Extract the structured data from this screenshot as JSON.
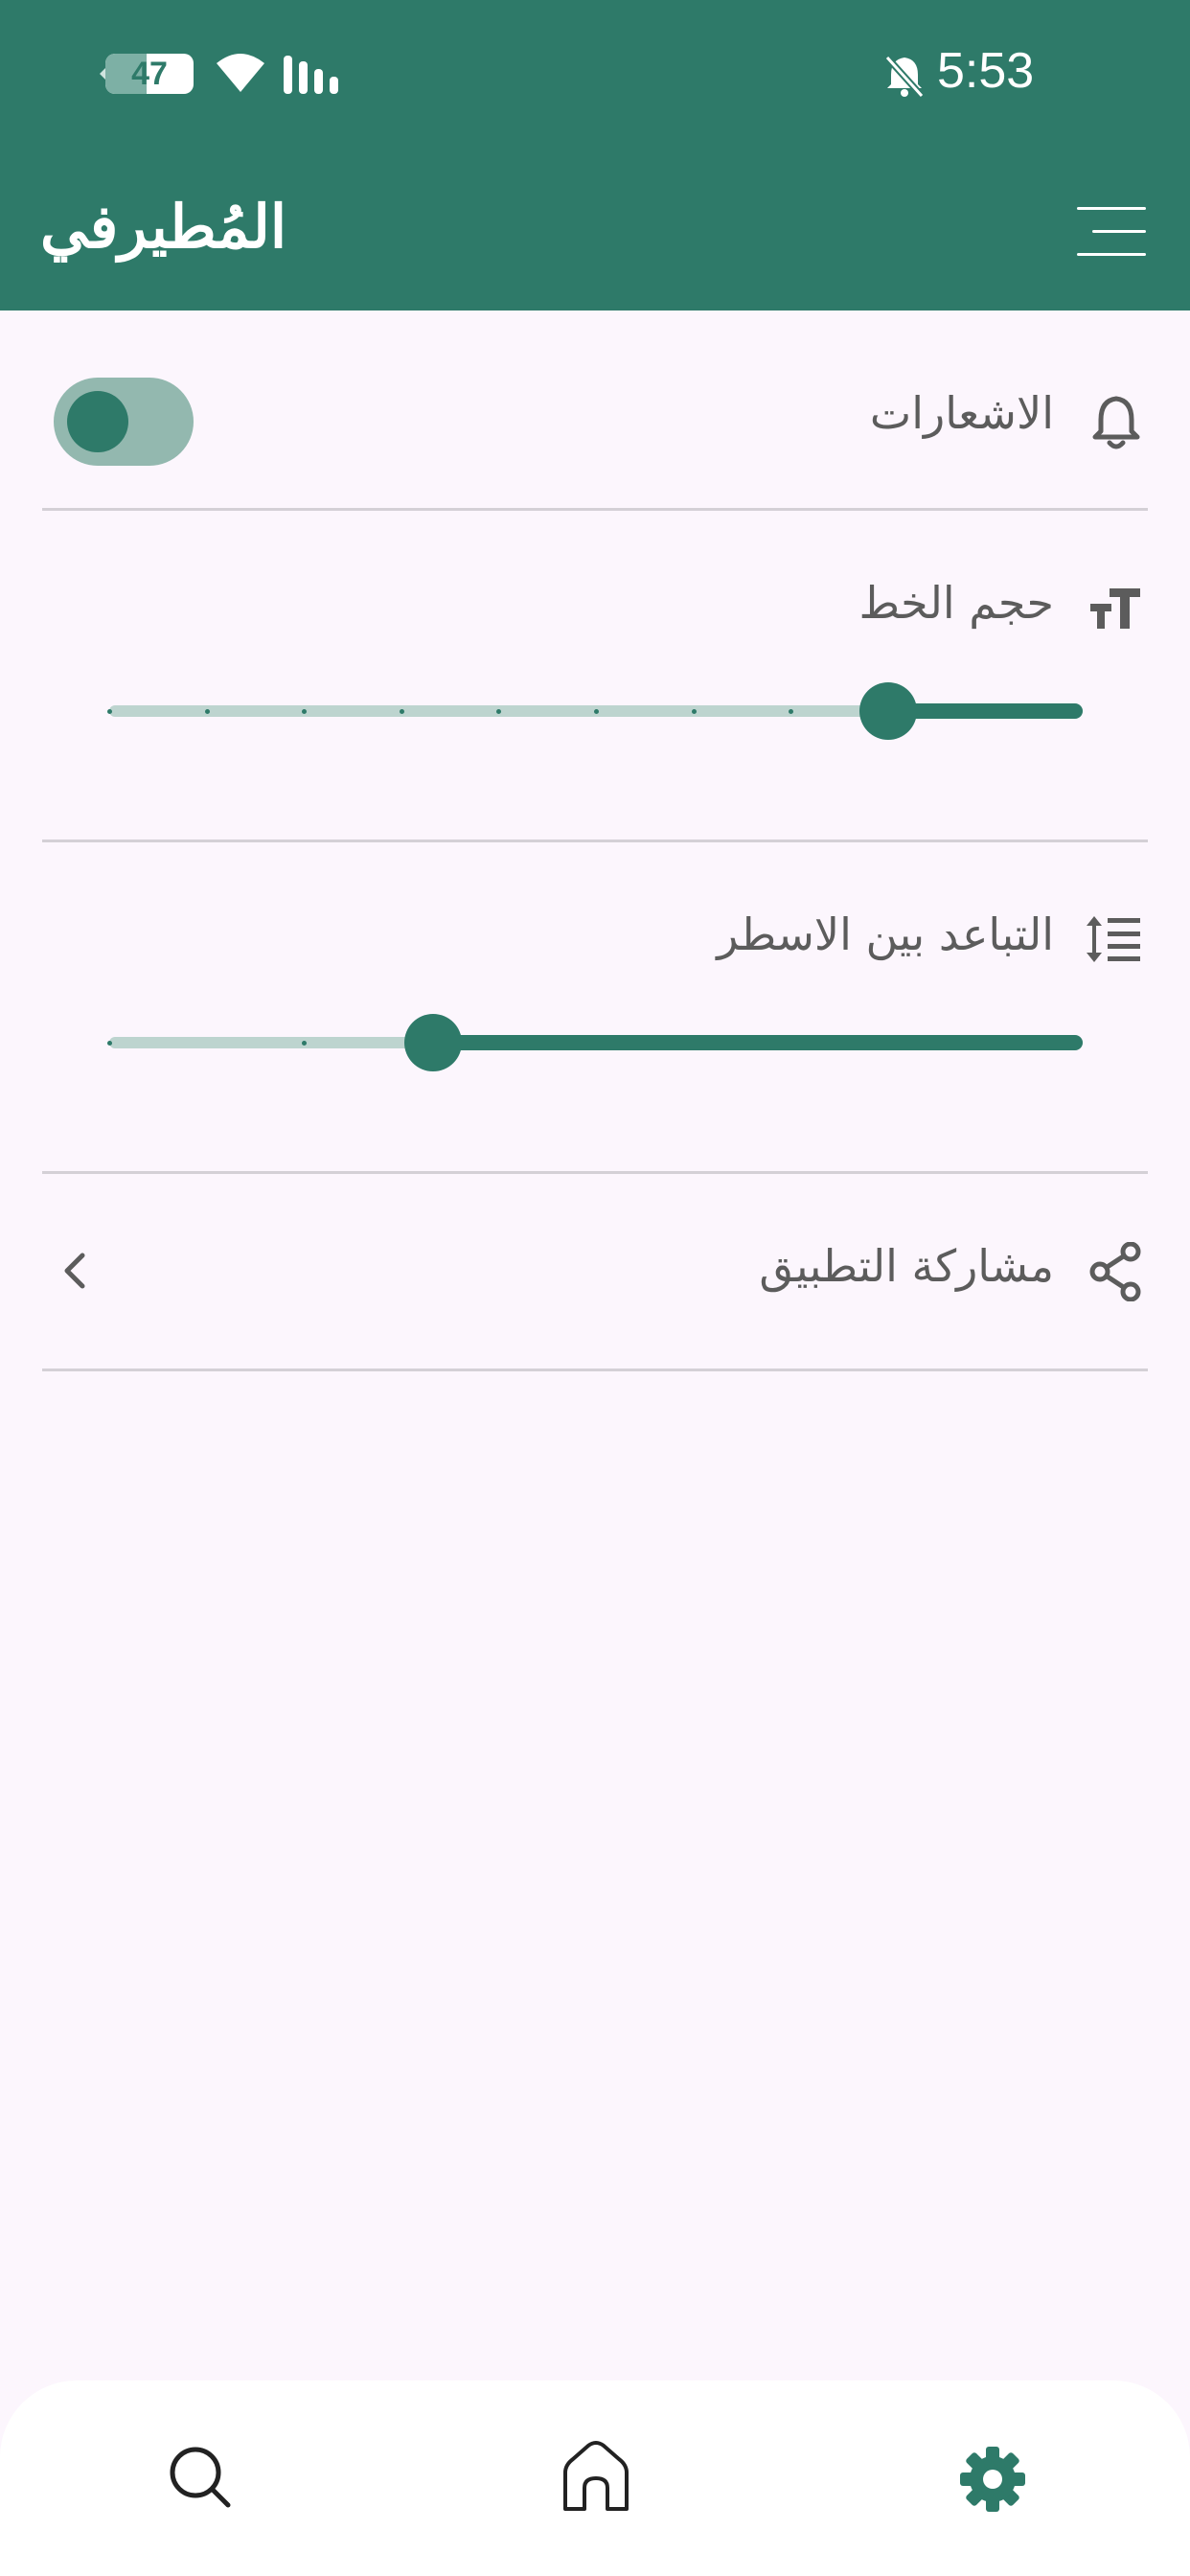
{
  "status_bar": {
    "battery_level": "47",
    "battery_fraction": 0.47,
    "time": "5:53",
    "icons": [
      "battery-icon",
      "wifi-icon",
      "signal-icon",
      "notifications-muted-icon"
    ]
  },
  "app_bar": {
    "logo_text": "المُطيرفي",
    "menu_icon": "menu-icon"
  },
  "settings": {
    "notifications": {
      "label": "الاشعارات",
      "icon": "bell-icon",
      "enabled": true
    },
    "font_size": {
      "label": "حجم الخط",
      "icon": "text-size-icon",
      "steps": 10,
      "value_fraction": 0.2
    },
    "line_spacing": {
      "label": "التباعد بين الاسطر",
      "icon": "line-spacing-icon",
      "steps": 5,
      "value_fraction": 0.667
    },
    "share_app": {
      "label": "مشاركة التطبيق",
      "icon": "share-icon"
    }
  },
  "bottom_nav": {
    "items": [
      {
        "name": "search",
        "icon": "search-icon",
        "active": false
      },
      {
        "name": "home",
        "icon": "home-icon",
        "active": false
      },
      {
        "name": "settings",
        "icon": "gear-icon",
        "active": true
      }
    ]
  },
  "colors": {
    "primary": "#2E7A69",
    "primary_light": "#93B8AF",
    "track_inactive": "#BDD4CF",
    "background": "#FCF6FD",
    "text": "#5C5C5C"
  }
}
